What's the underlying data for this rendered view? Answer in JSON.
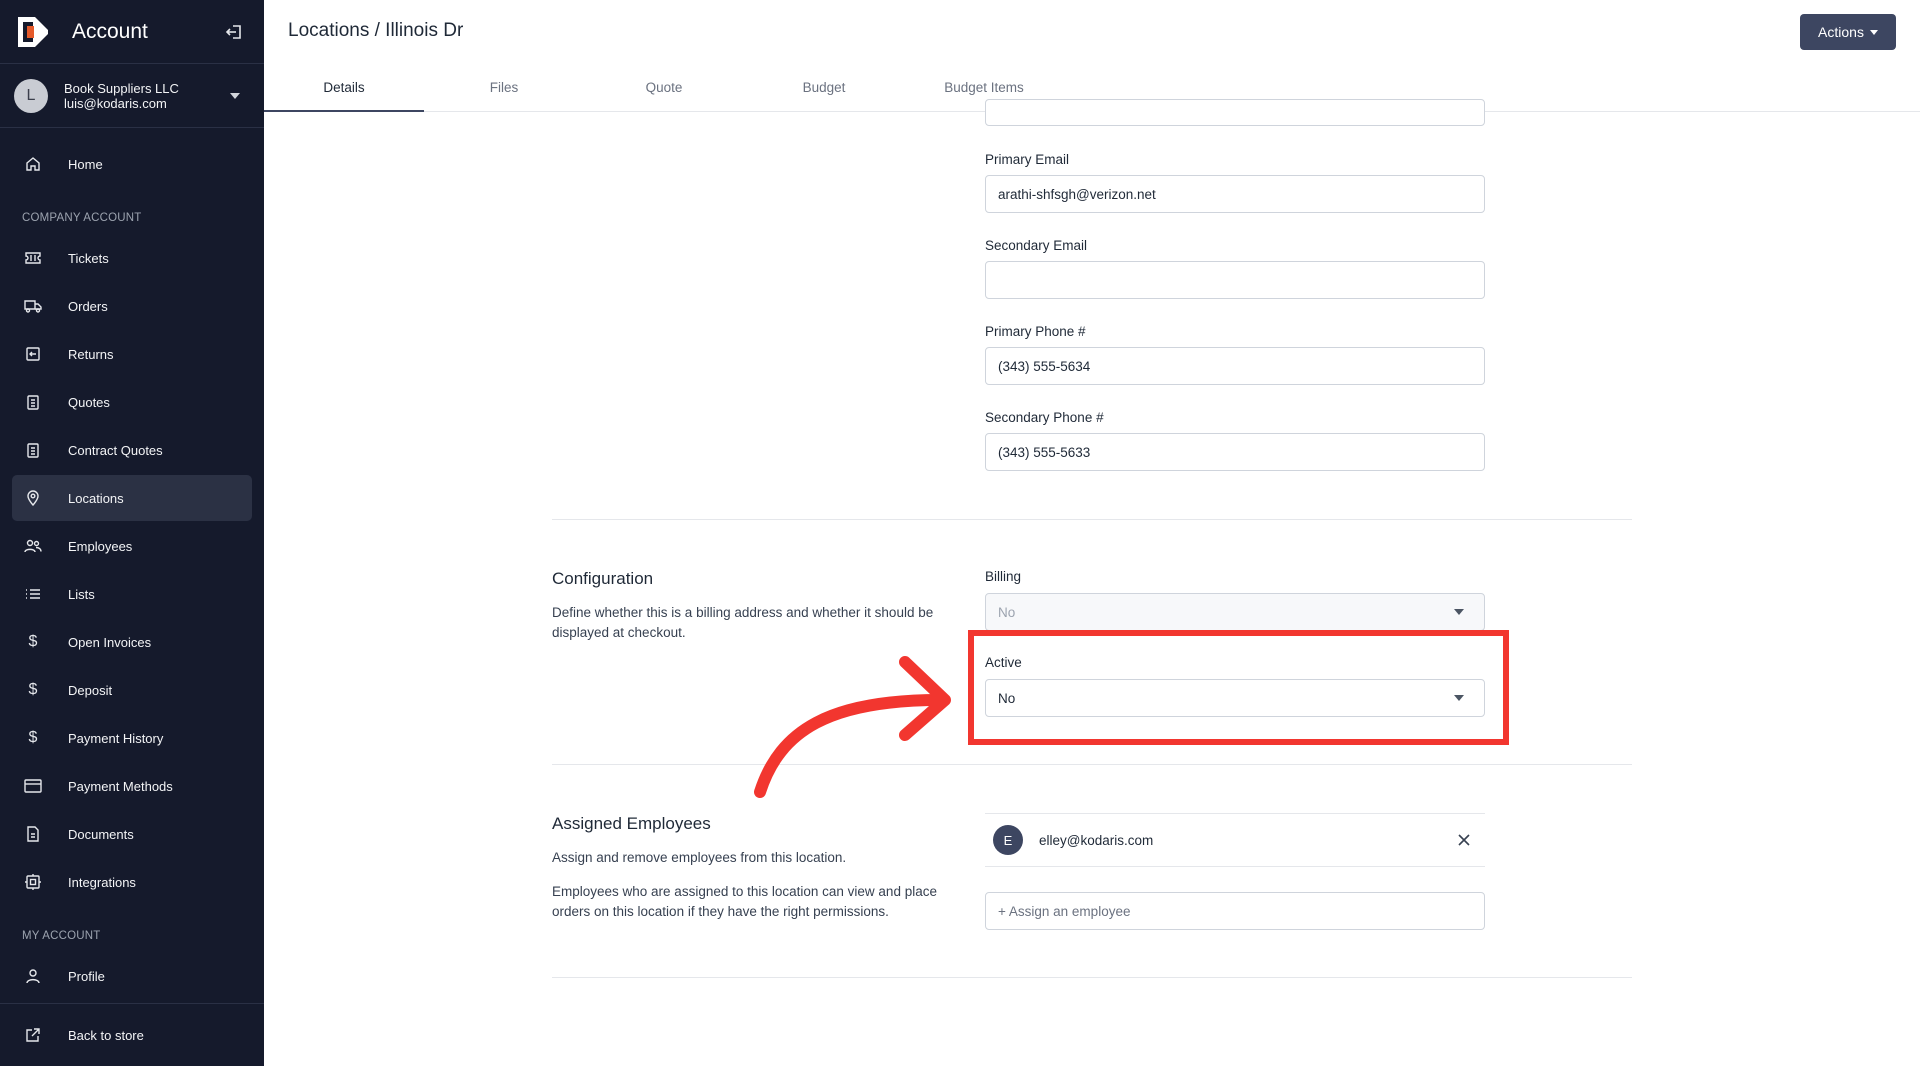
{
  "sidebar": {
    "title": "Account",
    "account": {
      "initial": "L",
      "name": "Book Suppliers LLC",
      "email": "luis@kodaris.com"
    },
    "home": {
      "label": "Home",
      "icon": "home-icon"
    },
    "company_section_label": "COMPANY ACCOUNT",
    "company_items": [
      {
        "label": "Tickets",
        "icon": "ticket-icon"
      },
      {
        "label": "Orders",
        "icon": "truck-icon"
      },
      {
        "label": "Returns",
        "icon": "return-icon"
      },
      {
        "label": "Quotes",
        "icon": "clipboard-icon"
      },
      {
        "label": "Contract Quotes",
        "icon": "clipboard-icon"
      },
      {
        "label": "Locations",
        "icon": "map-pin-icon",
        "active": true
      },
      {
        "label": "Employees",
        "icon": "users-icon"
      },
      {
        "label": "Lists",
        "icon": "list-icon"
      },
      {
        "label": "Open Invoices",
        "icon": "dollar-icon"
      },
      {
        "label": "Deposit",
        "icon": "dollar-icon"
      },
      {
        "label": "Payment History",
        "icon": "dollar-icon"
      },
      {
        "label": "Payment Methods",
        "icon": "credit-card-icon"
      },
      {
        "label": "Documents",
        "icon": "document-icon"
      },
      {
        "label": "Integrations",
        "icon": "integration-icon"
      }
    ],
    "my_account_section_label": "MY ACCOUNT",
    "profile": {
      "label": "Profile",
      "icon": "user-icon"
    },
    "back_to_store": {
      "label": "Back to store",
      "icon": "external-link-icon"
    }
  },
  "header": {
    "title": "Locations / Illinois Dr",
    "actions_label": "Actions",
    "tabs": [
      {
        "label": "Details",
        "active": true
      },
      {
        "label": "Files"
      },
      {
        "label": "Quote"
      },
      {
        "label": "Budget"
      },
      {
        "label": "Budget Items"
      }
    ]
  },
  "contact": {
    "primary_email_label": "Primary Email",
    "primary_email": "arathi-shfsgh@verizon.net",
    "secondary_email_label": "Secondary Email",
    "secondary_email": "",
    "primary_phone_label": "Primary Phone #",
    "primary_phone": "(343) 555-5634",
    "secondary_phone_label": "Secondary Phone #",
    "secondary_phone": "(343) 555-5633"
  },
  "configuration": {
    "title": "Configuration",
    "description": "Define whether this is a billing address and whether it should be displayed at checkout.",
    "billing_label": "Billing",
    "billing_value": "No",
    "active_label": "Active",
    "active_value": "No"
  },
  "employees": {
    "title": "Assigned Employees",
    "description_1": "Assign and remove employees from this location.",
    "description_2": "Employees who are assigned to this location can view and place orders on this location if they have the right permissions.",
    "assigned": [
      {
        "initial": "E",
        "email": "elley@kodaris.com"
      }
    ],
    "assign_placeholder": "+ Assign an employee"
  },
  "annotation": {
    "color": "#f2362f"
  },
  "colors": {
    "sidebar_bg": "#151a2c",
    "accent": "#3d4661"
  }
}
